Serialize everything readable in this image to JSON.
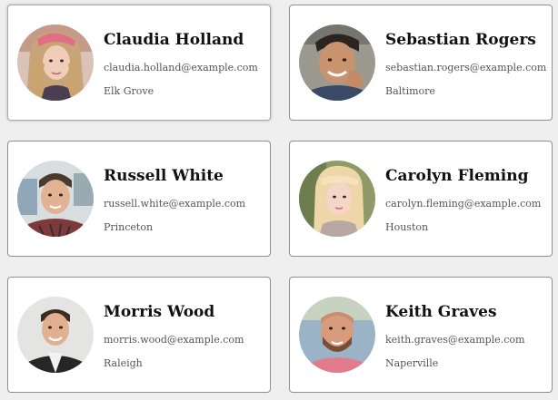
{
  "people": [
    {
      "name": "Claudia Holland",
      "email": "claudia.holland@example.com",
      "city": "Elk Grove"
    },
    {
      "name": "Sebastian Rogers",
      "email": "sebastian.rogers@example.com",
      "city": "Baltimore"
    },
    {
      "name": "Russell White",
      "email": "russell.white@example.com",
      "city": "Princeton"
    },
    {
      "name": "Carolyn Fleming",
      "email": "carolyn.fleming@example.com",
      "city": "Houston"
    },
    {
      "name": "Morris Wood",
      "email": "morris.wood@example.com",
      "city": "Raleigh"
    },
    {
      "name": "Keith Graves",
      "email": "keith.graves@example.com",
      "city": "Naperville"
    }
  ],
  "colors": {
    "page_background": "#efefef",
    "card_background": "#ffffff",
    "card_border": "#8f8f8f",
    "name_text": "#111111",
    "detail_text": "#555555"
  }
}
